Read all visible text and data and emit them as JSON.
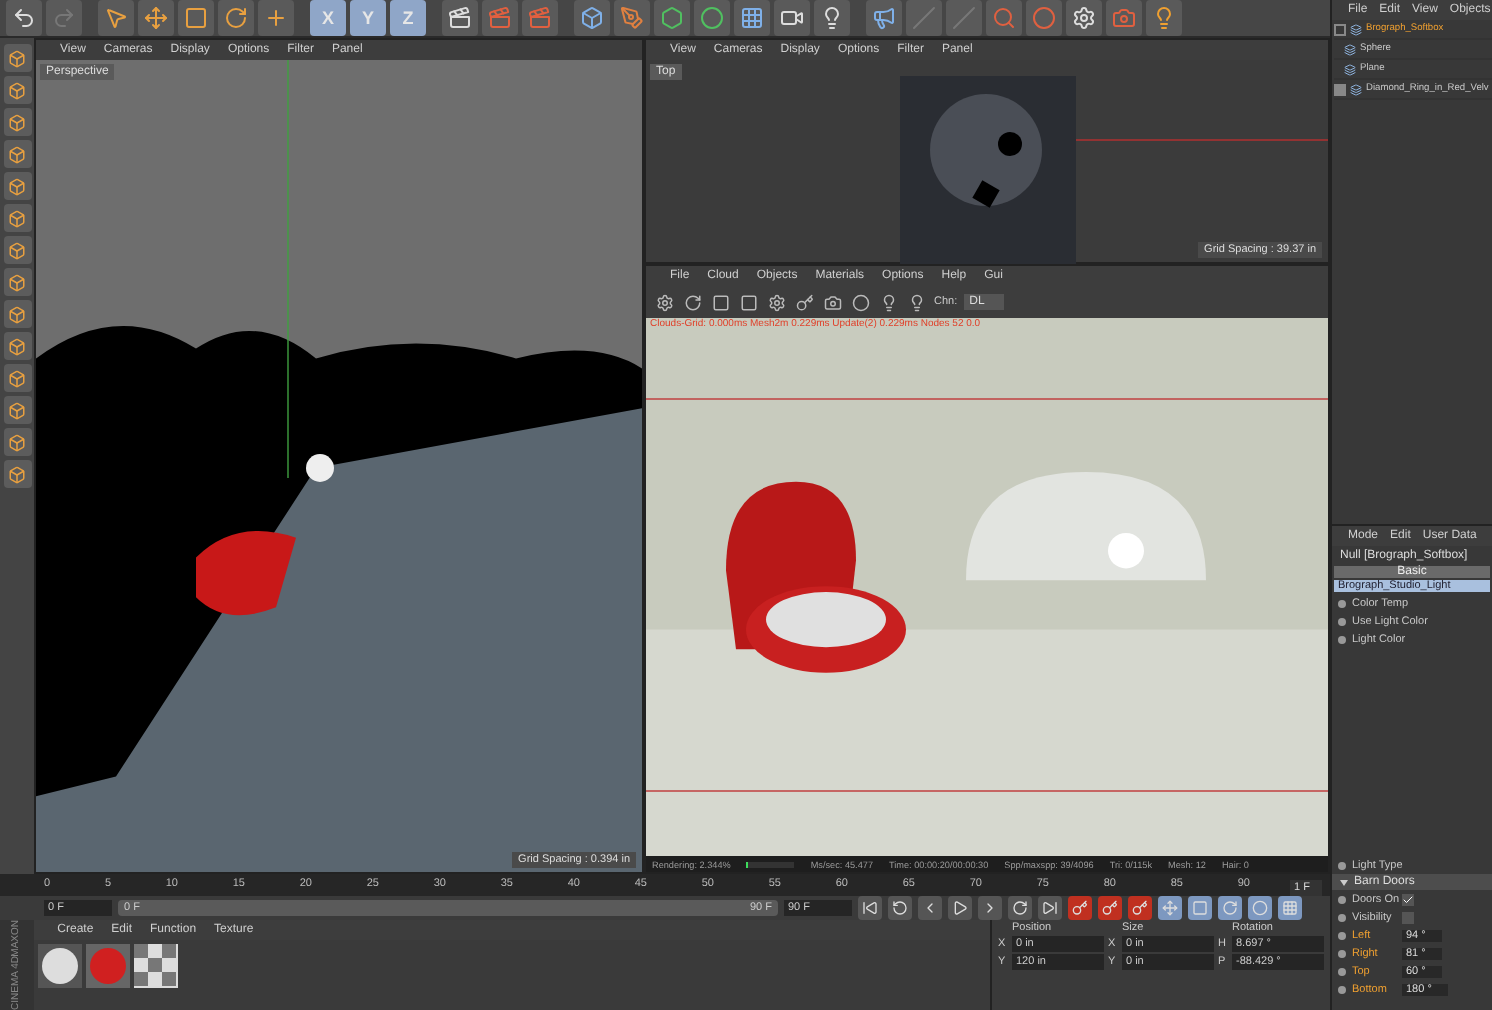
{
  "toolbar": {
    "axes": [
      {
        "label": "X",
        "on": true
      },
      {
        "label": "Y",
        "on": true
      },
      {
        "label": "Z",
        "on": true
      }
    ]
  },
  "perspective_view": {
    "menu": [
      "View",
      "Cameras",
      "Display",
      "Options",
      "Filter",
      "Panel"
    ],
    "label": "Perspective",
    "grid_spacing": "Grid Spacing : 0.394 in"
  },
  "top_view": {
    "menu": [
      "View",
      "Cameras",
      "Display",
      "Options",
      "Filter",
      "Panel"
    ],
    "label": "Top",
    "grid_spacing": "Grid Spacing : 39.37 in"
  },
  "render_view": {
    "menu": [
      "File",
      "Cloud",
      "Objects",
      "Materials",
      "Options",
      "Help",
      "Gui"
    ],
    "channel_label": "Chn:",
    "channel": "DL",
    "info": "Clouds-Grid: 0.000ms  Mesh2m 0.229ms  Update(2) 0.229ms  Nodes 52  0.0",
    "progress": {
      "level": 0.023
    },
    "stats": [
      "Rendering: 2.344%",
      "Ms/sec: 45.477",
      "Time: 00:00:20/00:00:30",
      "Spp/maxspp: 39/4096",
      "Tri: 0/115k",
      "Mesh: 12",
      "Hair: 0"
    ]
  },
  "timeline": {
    "ticks": [
      "0",
      "5",
      "10",
      "15",
      "20",
      "25",
      "30",
      "35",
      "40",
      "45",
      "50",
      "55",
      "60",
      "65",
      "70",
      "75",
      "80",
      "85",
      "90"
    ],
    "current_frame": "1 F"
  },
  "transport": {
    "start": "0 F",
    "range_start": "0 F",
    "range_end": "90 F",
    "end": "90 F"
  },
  "material_manager": {
    "menu": [
      "Create",
      "Edit",
      "Function",
      "Texture"
    ]
  },
  "brand": [
    "MAXON",
    "CINEMA 4D"
  ],
  "coordinates": {
    "headers": [
      "Position",
      "Size",
      "Rotation"
    ],
    "rows": [
      {
        "axis": "X",
        "position": "0 in",
        "size_axis": "X",
        "size": "0 in",
        "rot_axis": "H",
        "rotation": "8.697 °"
      },
      {
        "axis": "Y",
        "position": "120 in",
        "size_axis": "Y",
        "size": "0 in",
        "rot_axis": "P",
        "rotation": "-88.429 °"
      }
    ]
  },
  "object_manager": {
    "menu": [
      "File",
      "Edit",
      "View",
      "Objects"
    ],
    "items": [
      {
        "name": "Brograph_Softbox",
        "selected": true,
        "expanded": true,
        "children": [
          {
            "name": "Sphere",
            "selected": false
          },
          {
            "name": "Plane",
            "selected": false
          }
        ]
      },
      {
        "name": "Diamond_Ring_in_Red_Velv",
        "selected": false,
        "expanded": false
      }
    ]
  },
  "attribute_manager": {
    "menu": [
      "Mode",
      "Edit",
      "User Data"
    ],
    "object": "Null [Brograph_Softbox]",
    "tab": "Basic",
    "group": "Brograph_Studio_Light",
    "params": [
      "Color Temp",
      "Use Light Color",
      "Light Color"
    ],
    "light_type": "Light Type",
    "section": {
      "title": "Barn Doors",
      "expanded": true
    },
    "rows": [
      {
        "kind": "check",
        "label": "Doors On",
        "checked": true
      },
      {
        "kind": "check",
        "label": "Visibility",
        "checked": false
      },
      {
        "kind": "value",
        "label": "Left",
        "value": "94 °",
        "keyed": true
      },
      {
        "kind": "value",
        "label": "Right",
        "value": "81 °",
        "keyed": true
      },
      {
        "kind": "value",
        "label": "Top",
        "value": "60 °",
        "keyed": true
      },
      {
        "kind": "value",
        "label": "Bottom",
        "value": "180 °",
        "keyed": true
      }
    ]
  }
}
